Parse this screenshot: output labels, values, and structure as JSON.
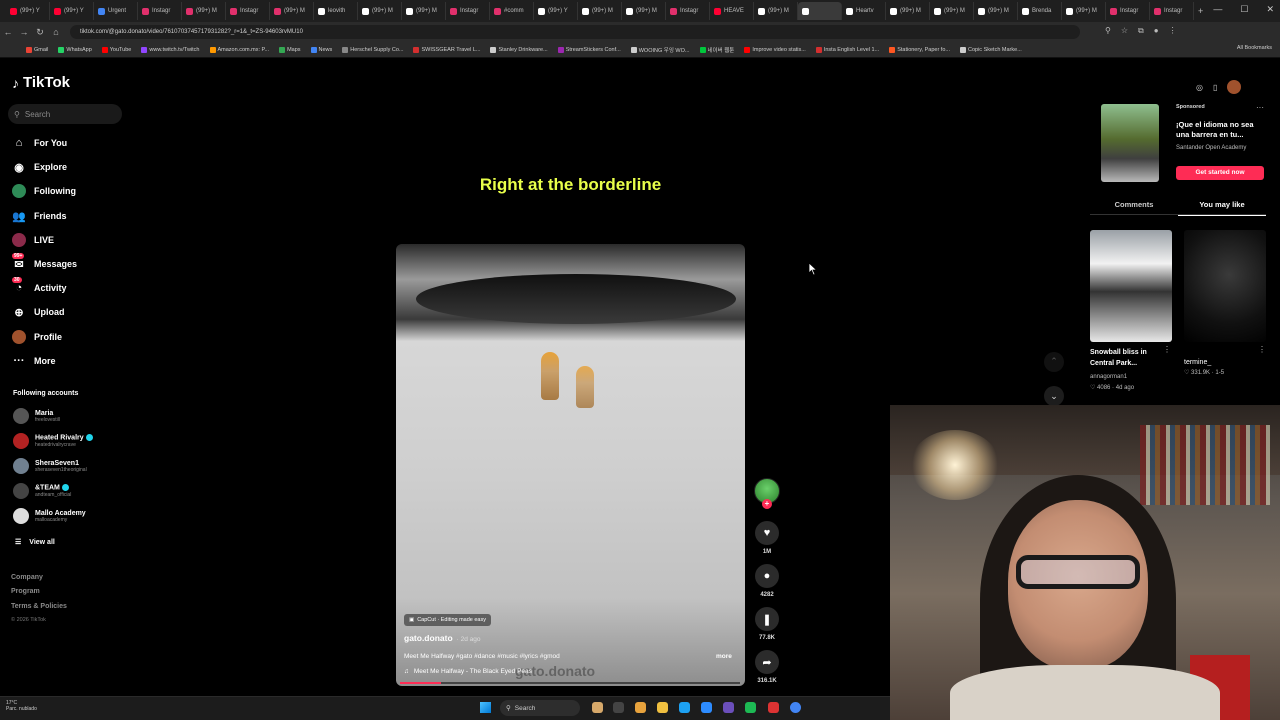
{
  "browser": {
    "tabs": [
      {
        "label": "(99+) Y",
        "color": "#ff0033"
      },
      {
        "label": "(99+) Y",
        "color": "#ff0033"
      },
      {
        "label": "Urgent",
        "color": "#4285f4"
      },
      {
        "label": "Instagr",
        "color": "#e1306c"
      },
      {
        "label": "(99+) M",
        "color": "#e1306c"
      },
      {
        "label": "Instagr",
        "color": "#e1306c"
      },
      {
        "label": "(99+) M",
        "color": "#e1306c"
      },
      {
        "label": "leovith",
        "color": "#ffffff"
      },
      {
        "label": "(99+) M",
        "color": "#ffffff"
      },
      {
        "label": "(99+) M",
        "color": "#ffffff"
      },
      {
        "label": "Instagr",
        "color": "#e1306c"
      },
      {
        "label": "#comm",
        "color": "#e1306c"
      },
      {
        "label": "(99+) Y",
        "color": "#ffffff"
      },
      {
        "label": "(99+) M",
        "color": "#ffffff"
      },
      {
        "label": "(99+) M",
        "color": "#ffffff"
      },
      {
        "label": "Instagr",
        "color": "#e1306c"
      },
      {
        "label": "HEAVE",
        "color": "#ff0033"
      },
      {
        "label": "(99+) M",
        "color": "#ffffff"
      },
      {
        "label": "",
        "color": "#ffffff",
        "active": true
      },
      {
        "label": "Heartv",
        "color": "#ffffff"
      },
      {
        "label": "(99+) M",
        "color": "#ffffff"
      },
      {
        "label": "(99+) M",
        "color": "#ffffff"
      },
      {
        "label": "(99+) M",
        "color": "#ffffff"
      },
      {
        "label": "Brenda",
        "color": "#ffffff"
      },
      {
        "label": "(99+) M",
        "color": "#ffffff"
      },
      {
        "label": "Instagr",
        "color": "#e1306c"
      },
      {
        "label": "Instagr",
        "color": "#e1306c"
      }
    ],
    "url": "tiktok.com/@gato.donato/video/7610703745717931282?_r=1&_t=ZS-94603rvMU10",
    "bookmarks": [
      {
        "label": "Gmail",
        "color": "#ea4335"
      },
      {
        "label": "WhatsApp",
        "color": "#25d366"
      },
      {
        "label": "YouTube",
        "color": "#ff0000"
      },
      {
        "label": "www.twitch.tv/Twitch",
        "color": "#9146ff"
      },
      {
        "label": "Amazon.com.mx: P...",
        "color": "#ff9900"
      },
      {
        "label": "Maps",
        "color": "#34a853"
      },
      {
        "label": "News",
        "color": "#4285f4"
      },
      {
        "label": "Herschel Supply Co...",
        "color": "#888888"
      },
      {
        "label": "SWISSGEAR Travel L...",
        "color": "#d32f2f"
      },
      {
        "label": "Stanley Drinkware...",
        "color": "#cccccc"
      },
      {
        "label": "StreamStickers Conf...",
        "color": "#9c27b0"
      },
      {
        "label": "WOOING 우잉 WO...",
        "color": "#cccccc"
      },
      {
        "label": "네이버 웹툰",
        "color": "#00c73c"
      },
      {
        "label": "Improve video statis...",
        "color": "#ff0000"
      },
      {
        "label": "Insta English Level 1...",
        "color": "#d32f2f"
      },
      {
        "label": "Stationery, Paper fo...",
        "color": "#ff5722"
      },
      {
        "label": "Copic Sketch Marke...",
        "color": "#cccccc"
      }
    ],
    "all_bookmarks": "All Bookmarks"
  },
  "tiktok": {
    "logo": "TikTok",
    "search_placeholder": "Search",
    "nav": [
      {
        "label": "For You",
        "icon": "home-icon"
      },
      {
        "label": "Explore",
        "icon": "compass-icon"
      },
      {
        "label": "Following",
        "icon": "following-icon"
      },
      {
        "label": "Friends",
        "icon": "friends-icon"
      },
      {
        "label": "LIVE",
        "icon": "live-icon"
      },
      {
        "label": "Messages",
        "icon": "messages-icon",
        "badge": "99+"
      },
      {
        "label": "Activity",
        "icon": "activity-icon",
        "badge": "30"
      },
      {
        "label": "Upload",
        "icon": "upload-icon"
      },
      {
        "label": "Profile",
        "icon": "profile-icon"
      },
      {
        "label": "More",
        "icon": "more-icon"
      }
    ],
    "following_title": "Following accounts",
    "accounts": [
      {
        "name": "Maria",
        "handle": "freelovestill",
        "verified": false,
        "color": "#555555"
      },
      {
        "name": "Heated Rivalry",
        "handle": "heatedrivalrycrave",
        "verified": true,
        "color": "#b22222"
      },
      {
        "name": "SheraSeven1",
        "handle": "sheraseven1theoriginal",
        "verified": false,
        "color": "#708090"
      },
      {
        "name": "&TEAM",
        "handle": "andteam_official",
        "verified": true,
        "color": "#444444"
      },
      {
        "name": "Mallo Academy",
        "handle": "malloacademy",
        "verified": false,
        "color": "#dddddd"
      }
    ],
    "view_all": "View all",
    "footer": [
      "Company",
      "Program",
      "Terms & Policies"
    ],
    "copyright": "© 2026 TikTok"
  },
  "video": {
    "overlay_text": "Right at the borderline",
    "capcut_label": "CapCut · Editing made easy",
    "author": "gato.donato",
    "date": "· 2d ago",
    "caption": "Meet Me Halfway #gato #dance #music #lyrics #gmod",
    "more": "more",
    "music": "Meet Me Halfway - The Black Eyed Peas",
    "watermark": "gato.donato",
    "progress_fraction": 0.12
  },
  "actions": {
    "likes": "1M",
    "comments": "4282",
    "saves": "77.8K",
    "shares": "316.1K"
  },
  "right_panel": {
    "ad": {
      "sponsored": "Sponsored",
      "title": "¡Que el idioma no sea una barrera en tu...",
      "brand": "Santander Open Academy",
      "cta": "Get started now"
    },
    "tabs": [
      {
        "label": "Comments",
        "active": false
      },
      {
        "label": "You may like",
        "active": true
      }
    ],
    "recommendations": [
      {
        "title": "Snowball bliss in Central Park...",
        "author": "annagorman1",
        "stats": "♡ 4086 · 4d ago"
      },
      {
        "title": "termine_",
        "author": "",
        "stats": "♡ 331.9K · 1-5"
      }
    ]
  },
  "taskbar": {
    "weather_temp": "17°C",
    "weather_desc": "Parc. nublado",
    "search": "Search"
  }
}
